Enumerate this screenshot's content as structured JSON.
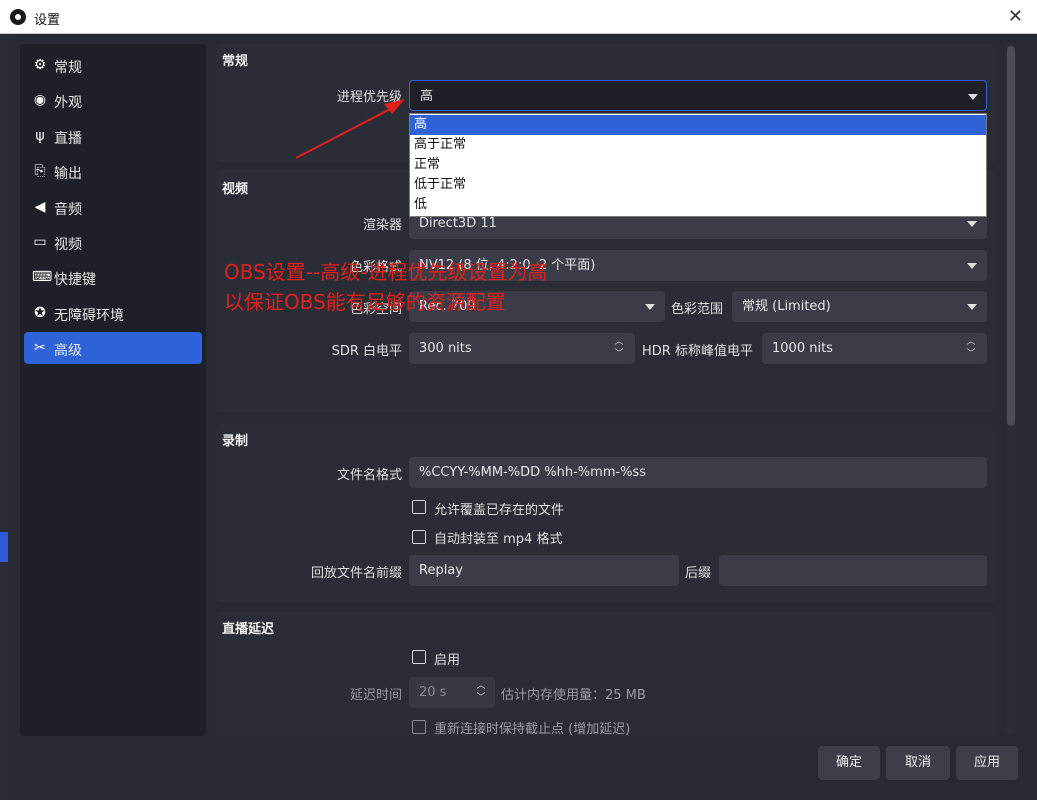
{
  "window": {
    "title": "设置"
  },
  "sidebar": {
    "items": [
      {
        "label": "常规",
        "icon": "gear-icon",
        "glyph": "⚙"
      },
      {
        "label": "外观",
        "icon": "appearance-icon",
        "glyph": "◉"
      },
      {
        "label": "直播",
        "icon": "antenna-icon",
        "glyph": "ψ"
      },
      {
        "label": "输出",
        "icon": "output-icon",
        "glyph": "⎘"
      },
      {
        "label": "音频",
        "icon": "speaker-icon",
        "glyph": "◀"
      },
      {
        "label": "视频",
        "icon": "monitor-icon",
        "glyph": "▭"
      },
      {
        "label": "快捷键",
        "icon": "keyboard-icon",
        "glyph": "⌨"
      },
      {
        "label": "无障碍环境",
        "icon": "accessibility-icon",
        "glyph": "✪"
      },
      {
        "label": "高级",
        "icon": "wrench-icon",
        "glyph": "✂"
      }
    ],
    "active_index": 8,
    "active_color": "#2f62d6"
  },
  "general": {
    "title": "常规",
    "priority_label": "进程优先级",
    "priority_value": "高",
    "priority_options": [
      "高",
      "高于正常",
      "正常",
      "低于正常",
      "低"
    ]
  },
  "video": {
    "title": "视频",
    "renderer_label": "渲染器",
    "renderer_value": "Direct3D 11",
    "color_format_label": "色彩格式",
    "color_format_value": "NV12 (8 位, 4:2:0, 2 个平面)",
    "color_space_label": "色彩空间",
    "color_space_value": "Rec. 709",
    "color_range_label": "色彩范围",
    "color_range_value": "常规 (Limited)",
    "sdr_label": "SDR 白电平",
    "sdr_value": "300 nits",
    "hdr_label": "HDR 标称峰值电平",
    "hdr_value": "1000 nits"
  },
  "recording": {
    "title": "录制",
    "filename_label": "文件名格式",
    "filename_value": "%CCYY-%MM-%DD %hh-%mm-%ss",
    "overwrite_label": "允许覆盖已存在的文件",
    "remux_label": "自动封装至 mp4 格式",
    "replay_prefix_label": "回放文件名前缀",
    "replay_prefix_value": "Replay",
    "suffix_label": "后缀",
    "suffix_value": ""
  },
  "stream_delay": {
    "title": "直播延迟",
    "enable_label": "启用",
    "delay_label": "延迟时间",
    "delay_value": "20 s",
    "memory_text": "估计内存使用量：25 MB",
    "preserve_label": "重新连接时保持截止点 (增加延迟)"
  },
  "buttons": {
    "ok": "确定",
    "cancel": "取消",
    "apply": "应用"
  },
  "annotation": {
    "line1": "OBS设置--高级-进程优先级设置为高",
    "line2": "以保证OBS能有足够的资源配置",
    "color": "#e0201c"
  }
}
